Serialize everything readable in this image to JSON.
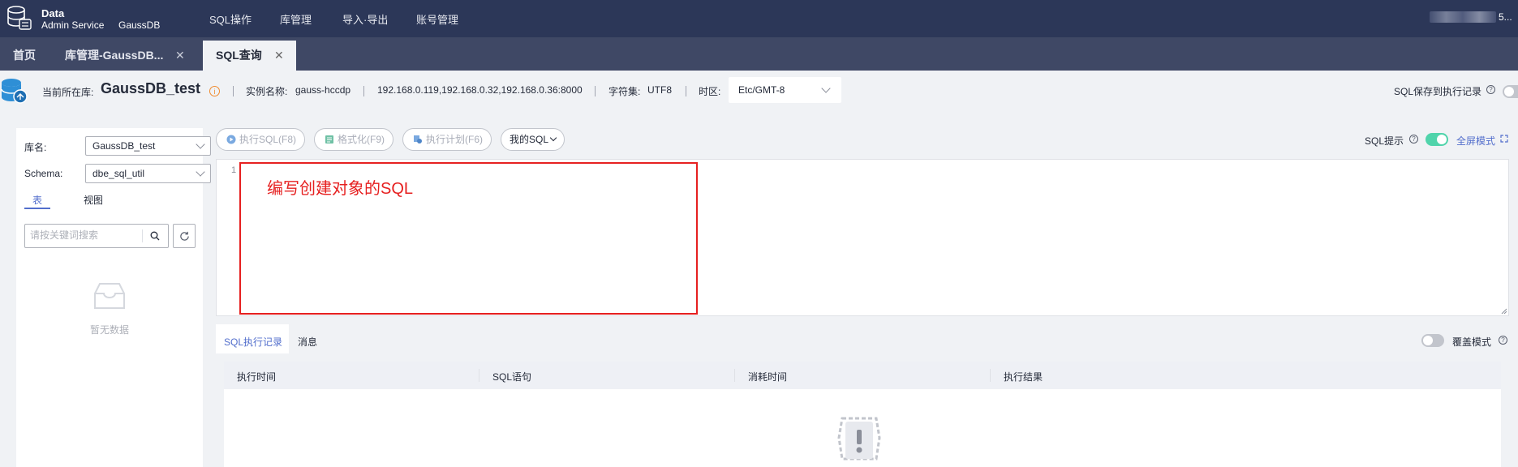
{
  "header": {
    "brand_line1": "Data",
    "brand_line2": "Admin Service",
    "brand_product": "GaussDB",
    "menu": [
      "SQL操作",
      "库管理",
      "导入·导出",
      "账号管理"
    ],
    "user_suffix": "5..."
  },
  "tabs": [
    {
      "label": "首页"
    },
    {
      "label": "库管理-GaussDB..."
    },
    {
      "label": "SQL查询"
    }
  ],
  "info": {
    "current_db_label": "当前所在库:",
    "current_db": "GaussDB_test",
    "instance_label": "实例名称:",
    "instance_name": "gauss-hccdp",
    "addresses": "192.168.0.119,192.168.0.32,192.168.0.36:8000",
    "charset_label": "字符集:",
    "charset": "UTF8",
    "timezone_label": "时区:",
    "timezone": "Etc/GMT-8",
    "save_to_history_label": "SQL保存到执行记录"
  },
  "left": {
    "db_label": "库名:",
    "db_value": "GaussDB_test",
    "schema_label": "Schema:",
    "schema_value": "dbe_sql_util",
    "tab_table": "表",
    "tab_view": "视图",
    "search_placeholder": "请按关键词搜索",
    "empty_text": "暂无数据"
  },
  "toolbar": {
    "execute_sql": "执行SQL(F8)",
    "format": "格式化(F9)",
    "exec_plan": "执行计划(F6)",
    "my_sql": "我的SQL",
    "sql_hint": "SQL提示",
    "fullscreen": "全屏模式"
  },
  "editor": {
    "line_number": "1",
    "annotation": "编写创建对象的SQL"
  },
  "results": {
    "tab_history": "SQL执行记录",
    "tab_messages": "消息",
    "overwrite_mode": "覆盖模式",
    "columns": [
      "执行时间",
      "SQL语句",
      "消耗时间",
      "执行结果"
    ]
  },
  "colors": {
    "nav_bg": "#2c3758",
    "tabs_bg": "#3f4865",
    "accent": "#526ecc",
    "toggle_on": "#50d4ab",
    "annotation_red": "#e62020"
  }
}
